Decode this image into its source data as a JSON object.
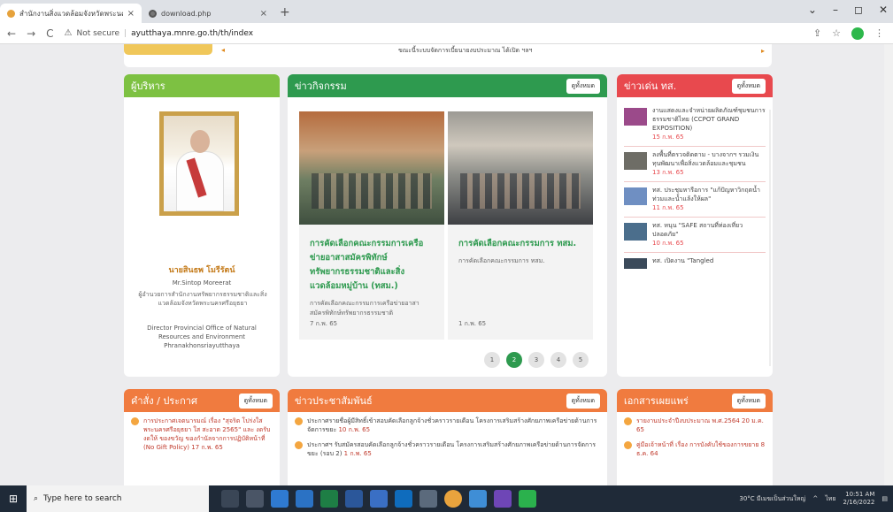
{
  "browser": {
    "tabs": [
      {
        "title": "สำนักงานสิ่งแวดล้อมจังหวัดพระนครศรีอยุธยา",
        "close": "×"
      },
      {
        "title": "download.php",
        "close": "×"
      }
    ],
    "new_tab": "+",
    "window_controls": [
      "⌄",
      "–",
      "◻",
      "✕"
    ],
    "back": "←",
    "forward": "→",
    "reload": "C",
    "security": "Not secure",
    "url": "ayutthaya.mnre.go.th/th/index"
  },
  "page": {
    "top_strip_text": "ขณะนี้ระบบจัดการเบี้ยนายงบประมาณ ได้เปิด ฯลฯ",
    "admin": {
      "header": "ผู้บริหาร",
      "name_th": "นายสินธพ โมรีรัตน์",
      "name_en": "Mr.Sintop Moreerat",
      "position_th": "ผู้อำนวยการสำนักงานทรัพยากรธรรมชาติและสิ่งแวดล้อมจังหวัดพระนครศรีอยุธยา",
      "position_en": "Director Provincial Office of Natural Resources and Environment Phranakhonsriayutthaya"
    },
    "activity": {
      "header": "ข่าวกิจกรรม",
      "more": "ดูทั้งหมด",
      "news": [
        {
          "title": "การคัดเลือกคณะกรรมการเครือข่ายอาสาสมัครพิทักษ์ทรัพยากรธรรมชาติและสิ่งแวดล้อมหมู่บ้าน (ทสม.)",
          "desc": "การคัดเลือกคณะกรรมการเครือข่ายอาสาสมัครพิทักษ์ทรัพยากรธรรมชาติ",
          "date": "7 ก.พ. 65"
        },
        {
          "title": "การคัดเลือกคณะกรรมการ ทสม.",
          "desc": "การคัดเลือกคณะกรรมการ ทสม.",
          "date": "1 ก.พ. 65"
        }
      ],
      "pages": [
        "1",
        "2",
        "3",
        "4",
        "5"
      ],
      "current_page": "2"
    },
    "hot": {
      "header": "ข่าวเด่น ทส.",
      "more": "ดูทั้งหมด",
      "items": [
        {
          "text": "งานแสดงและจำหน่ายผลิตภัณฑ์ชุมชนการธรรมชาติไทย (CCPOT GRAND EXPOSITION)",
          "date": "15 ก.พ. 65",
          "thumb": "#9b4a8a"
        },
        {
          "text": "ลงพื้นที่ตรวจติดตาม - บางจากฯ รวมเงินทุนพัฒนาเพื่อสิ่งแวดล้อมและชุมชน",
          "date": "13 ก.พ. 65",
          "thumb": "#6e6d66"
        },
        {
          "text": "ทส. ประชุมหารือการ \"แก้ปัญหาวิกฤตน้ำท่วมและน้ำแล้งให้ผล\"",
          "date": "11 ก.พ. 65",
          "thumb": "#6f8fc2"
        },
        {
          "text": "ทส. หนุน \"SAFE สถานที่ท่องเที่ยวปลอดภัย\"",
          "date": "10 ก.พ. 65",
          "thumb": "#4b6e8c"
        },
        {
          "text": "ทส. เปิดงาน \"Tangled",
          "date": "",
          "thumb": "#3b4a5a"
        }
      ]
    },
    "orders": {
      "header": "คำสั่ง / ประกาศ",
      "more": "ดูทั้งหมด",
      "items": [
        {
          "text": "การประกาศเจตนารมณ์ เรื่อง \"สุจริต โปร่งใส พระนครศรีอยุธยา ใส สะอาด 2565\" และ งดรับ งดให้ ของขวัญ ของกำนัลจากการปฏิบัติหน้าที่ (No Gift Policy)",
          "date": "17 ก.พ. 65"
        }
      ]
    },
    "pr": {
      "header": "ข่าวประชาสัมพันธ์",
      "more": "ดูทั้งหมด",
      "items": [
        {
          "text": "ประกาศรายชื่อผู้มีสิทธิ์เข้าสอบคัดเลือกลูกจ้างชั่วคราวรายเดือน โครงการเสริมสร้างศักยภาพเครือข่ายด้านการจัดการขยะ",
          "date": "10 ก.พ. 65"
        },
        {
          "text": "ประกาศฯ รับสมัครสอบคัดเลือกลูกจ้างชั่วคราวรายเดือน โครงการเสริมสร้างศักยภาพเครือข่ายด้านการจัดการขยะ (รอบ 2)",
          "date": "1 ก.พ. 65"
        }
      ]
    },
    "docs": {
      "header": "เอกสารเผยแพร่",
      "more": "ดูทั้งหมด",
      "items": [
        {
          "text": "รายงานประจำปีงบประมาณ พ.ศ.2564",
          "date": "20 ม.ค. 65"
        },
        {
          "text": "คู่มือเจ้าหน้าที่ เรื่อง การบังคับใช้ของการขยาย",
          "date": "8 ธ.ค. 64"
        }
      ]
    }
  },
  "taskbar": {
    "search_placeholder": "Type here to search",
    "tray": {
      "weather": "30°C มีเมฆเป็นส่วนใหญ่",
      "lang": "ไทย",
      "time": "10:51 AM",
      "date": "2/16/2022"
    }
  }
}
